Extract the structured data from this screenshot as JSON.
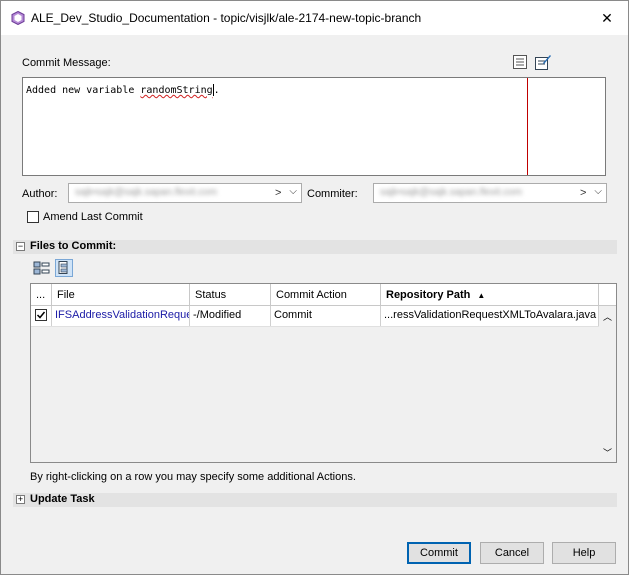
{
  "window": {
    "title": "ALE_Dev_Studio_Documentation - topic/visjlk/ale-2174-new-topic-branch",
    "close_glyph": "✕"
  },
  "commit_message": {
    "label": "Commit Message:",
    "text_before": "Added new variable ",
    "text_misspelled": "randomString",
    "text_after": "."
  },
  "author": {
    "label": "Author:",
    "value": "sajk•sajk@sajk.sapan.flexit.com",
    "suffix": ">"
  },
  "committer": {
    "label": "Commiter:",
    "value": "sajk•sajk@sajk.sapan.flexit.com",
    "suffix": ">"
  },
  "amend": {
    "label": "Amend Last Commit",
    "checked": false
  },
  "files_section": {
    "title": "Files to Commit:",
    "expanded": true,
    "columns": [
      "...",
      "File",
      "Status",
      "Commit Action",
      "Repository Path"
    ],
    "sort_indicator": "▲",
    "rows": [
      {
        "checked": true,
        "file": "IFSAddressValidationRequestXMLToAvalara.java",
        "status": "-/Modified",
        "commit_action": "Commit",
        "repository_path": "...ressValidationRequestXMLToAvalara.java"
      }
    ],
    "hint": "By right-clicking on a row you may specify some additional Actions."
  },
  "update_section": {
    "title": "Update Task",
    "expanded": false
  },
  "buttons": {
    "commit": "Commit",
    "cancel": "Cancel",
    "help": "Help"
  },
  "colors": {
    "accent": "#0063b1",
    "file_link": "#1a1aa6",
    "margin_line": "#c00000"
  }
}
